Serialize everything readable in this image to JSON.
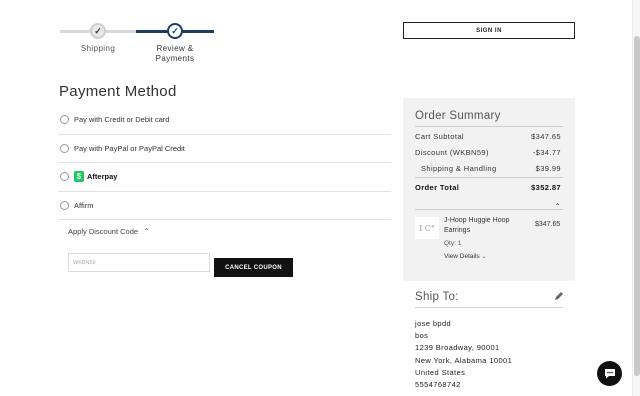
{
  "stepper": {
    "steps": [
      {
        "label": "Shipping"
      },
      {
        "label": "Review &\nPayments"
      }
    ]
  },
  "header": {
    "signin_label": "SIGN IN"
  },
  "payment": {
    "title": "Payment Method",
    "options": [
      {
        "label": "Pay with Credit or Debit card"
      },
      {
        "label": "Pay with PayPal or PayPal Credit"
      },
      {
        "label": "Afterpay"
      },
      {
        "label": "Affirm"
      }
    ],
    "discount_label": "Apply Discount Code",
    "coupon_value": "WKBN59",
    "cancel_coupon_label": "CANCEL COUPON"
  },
  "order_summary": {
    "title": "Order Summary",
    "rows": [
      {
        "label": "Cart Subtotal",
        "value": "$347.65"
      },
      {
        "label": "Discount (WKBN59)",
        "value": "-$34.77"
      },
      {
        "label": "Shipping & Handling",
        "value": "$39.99"
      }
    ],
    "total": {
      "label": "Order Total",
      "value": "$352.87"
    },
    "product": {
      "name": "J-Hoop Huggie Hoop Earrings",
      "price": "$347.65",
      "qty": "Qty: 1",
      "view_details": "View Details"
    }
  },
  "ship_to": {
    "title": "Ship To:",
    "lines": [
      "jose bpdd",
      "bos",
      "1239 Broadway, 90001",
      "New York, Alabama 10001",
      "United States",
      "5554768742"
    ]
  },
  "colors": {
    "accent": "#1c3f66",
    "afterpay": "#1ec962"
  },
  "icons": [
    "check-icon",
    "chevron-up-icon",
    "chevron-down-icon",
    "pencil-icon",
    "chat-icon",
    "afterpay-logo-icon"
  ]
}
